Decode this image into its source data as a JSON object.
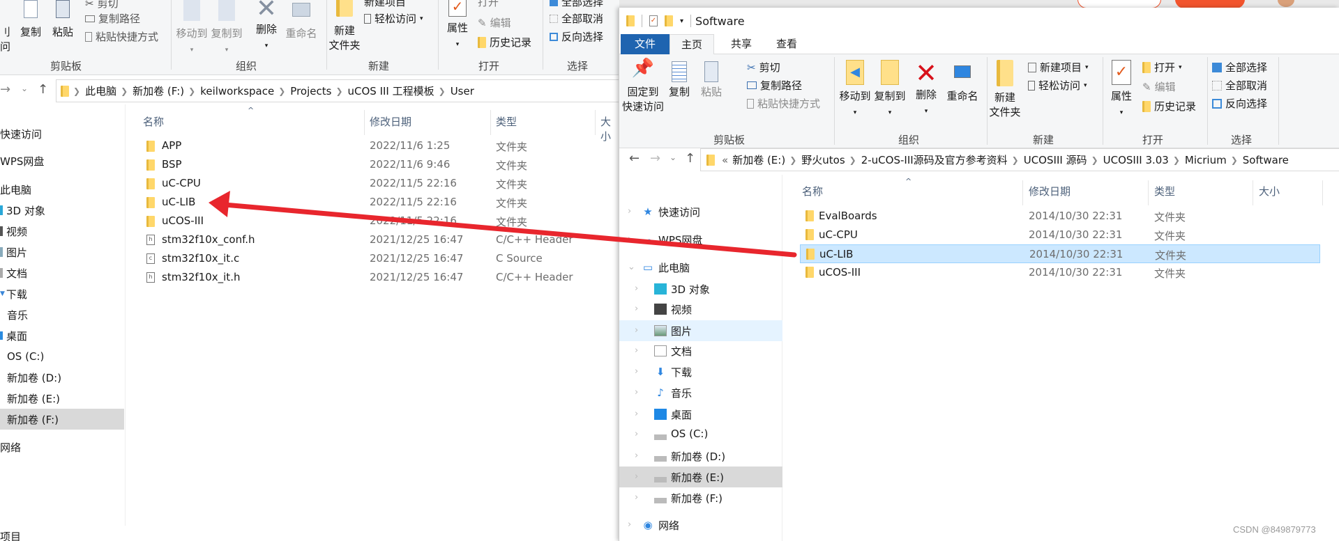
{
  "background": {
    "browser_strip_color": "#e9e9e9",
    "accent_orange": "#f2542d"
  },
  "left_window": {
    "ribbon": {
      "clipboard": {
        "pin_partial_1": "刂",
        "pin_partial_2": "问",
        "copy": "复制",
        "paste": "粘贴",
        "cut": "剪切",
        "copy_path": "复制路径",
        "paste_shortcut": "粘贴快捷方式",
        "label": "剪贴板"
      },
      "organize": {
        "move_to": "移动到",
        "copy_to": "复制到",
        "delete": "删除",
        "rename": "重命名",
        "label": "组织"
      },
      "new": {
        "new_item": "新建项目",
        "easy_access": "轻松访问",
        "new_folder_1": "新建",
        "new_folder_2": "文件夹",
        "label": "新建"
      },
      "open": {
        "properties": "属性",
        "open": "打开",
        "edit": "编辑",
        "history": "历史记录",
        "label": "打开"
      },
      "select": {
        "select_all": "全部选择",
        "select_none": "全部取消",
        "invert": "反向选择",
        "label": "选择"
      }
    },
    "breadcrumb": [
      "此电脑",
      "新加卷 (F:)",
      "keilworkspace",
      "Projects",
      "uCOS III 工程模板",
      "User"
    ],
    "nav": [
      {
        "label": "快速访问"
      },
      {
        "label": "WPS网盘"
      },
      {
        "label": "此电脑"
      },
      {
        "label": "3D 对象"
      },
      {
        "label": "视频"
      },
      {
        "label": "图片"
      },
      {
        "label": "文档"
      },
      {
        "label": "下载"
      },
      {
        "label": "音乐"
      },
      {
        "label": "桌面"
      },
      {
        "label": "OS (C:)"
      },
      {
        "label": "新加卷 (D:)"
      },
      {
        "label": "新加卷 (E:)"
      },
      {
        "label": "新加卷 (F:)",
        "selected": true
      },
      {
        "label": "网络"
      }
    ],
    "columns": {
      "name": "名称",
      "date": "修改日期",
      "type": "类型",
      "size": "大小"
    },
    "files": [
      {
        "name": "APP",
        "date": "2022/11/6 1:25",
        "type": "文件夹",
        "icon": "folder"
      },
      {
        "name": "BSP",
        "date": "2022/11/6 9:46",
        "type": "文件夹",
        "icon": "folder"
      },
      {
        "name": "uC-CPU",
        "date": "2022/11/5 22:16",
        "type": "文件夹",
        "icon": "folder"
      },
      {
        "name": "uC-LIB",
        "date": "2022/11/5 22:16",
        "type": "文件夹",
        "icon": "folder"
      },
      {
        "name": "uCOS-III",
        "date": "2022/11/5 22:16",
        "type": "文件夹",
        "icon": "folder"
      },
      {
        "name": "stm32f10x_conf.h",
        "date": "2021/12/25 16:47",
        "type": "C/C++ Header",
        "icon": "h-file"
      },
      {
        "name": "stm32f10x_it.c",
        "date": "2021/12/25 16:47",
        "type": "C Source",
        "icon": "c-file"
      },
      {
        "name": "stm32f10x_it.h",
        "date": "2021/12/25 16:47",
        "type": "C/C++ Header",
        "icon": "h-file"
      }
    ],
    "status_partial": "项目"
  },
  "right_window": {
    "title": "Software",
    "tabs": [
      {
        "label": "文件",
        "active_blue": true
      },
      {
        "label": "主页",
        "selected": true
      },
      {
        "label": "共享"
      },
      {
        "label": "查看"
      }
    ],
    "ribbon": {
      "clipboard": {
        "pin_1": "固定到",
        "pin_2": "快速访问",
        "copy": "复制",
        "paste": "粘贴",
        "cut": "剪切",
        "copy_path": "复制路径",
        "paste_shortcut": "粘贴快捷方式",
        "label": "剪贴板"
      },
      "organize": {
        "move_to": "移动到",
        "copy_to": "复制到",
        "delete": "删除",
        "rename": "重命名",
        "label": "组织"
      },
      "new": {
        "new_folder_1": "新建",
        "new_folder_2": "文件夹",
        "new_item": "新建项目",
        "easy_access": "轻松访问",
        "label": "新建"
      },
      "open": {
        "properties": "属性",
        "open": "打开",
        "edit": "编辑",
        "history": "历史记录",
        "label": "打开"
      },
      "select": {
        "select_all": "全部选择",
        "select_none": "全部取消",
        "invert": "反向选择",
        "label": "选择"
      }
    },
    "breadcrumb_overflow": "«",
    "breadcrumb": [
      "新加卷 (E:)",
      "野火utos",
      "2-uCOS-III源码及官方参考资料",
      "UCOSIII 源码",
      "UCOSIII 3.03",
      "Micrium",
      "Software"
    ],
    "nav": [
      {
        "label": "快速访问",
        "icon": "star-icon"
      },
      {
        "label": "WPS网盘",
        "icon": "cloud-icon"
      },
      {
        "label": "此电脑",
        "icon": "computer-icon",
        "expanded": true
      },
      {
        "label": "3D 对象",
        "icon": "cube-icon"
      },
      {
        "label": "视频",
        "icon": "film-icon"
      },
      {
        "label": "图片",
        "icon": "picture-icon",
        "hover": true
      },
      {
        "label": "文档",
        "icon": "document-icon"
      },
      {
        "label": "下载",
        "icon": "download-icon"
      },
      {
        "label": "音乐",
        "icon": "music-icon"
      },
      {
        "label": "桌面",
        "icon": "desktop-icon"
      },
      {
        "label": "OS (C:)",
        "icon": "windows-drive-icon"
      },
      {
        "label": "新加卷 (D:)",
        "icon": "drive-icon"
      },
      {
        "label": "新加卷 (E:)",
        "icon": "drive-icon",
        "selected": true
      },
      {
        "label": "新加卷 (F:)",
        "icon": "drive-icon"
      },
      {
        "label": "网络",
        "icon": "network-icon"
      }
    ],
    "columns": {
      "name": "名称",
      "date": "修改日期",
      "type": "类型",
      "size": "大小"
    },
    "files": [
      {
        "name": "EvalBoards",
        "date": "2014/10/30 22:31",
        "type": "文件夹"
      },
      {
        "name": "uC-CPU",
        "date": "2014/10/30 22:31",
        "type": "文件夹"
      },
      {
        "name": "uC-LIB",
        "date": "2014/10/30 22:31",
        "type": "文件夹",
        "selected": true
      },
      {
        "name": "uCOS-III",
        "date": "2014/10/30 22:31",
        "type": "文件夹"
      }
    ]
  },
  "annotation": {
    "arrow_color": "#e8262d"
  },
  "watermark": "CSDN @849879773"
}
